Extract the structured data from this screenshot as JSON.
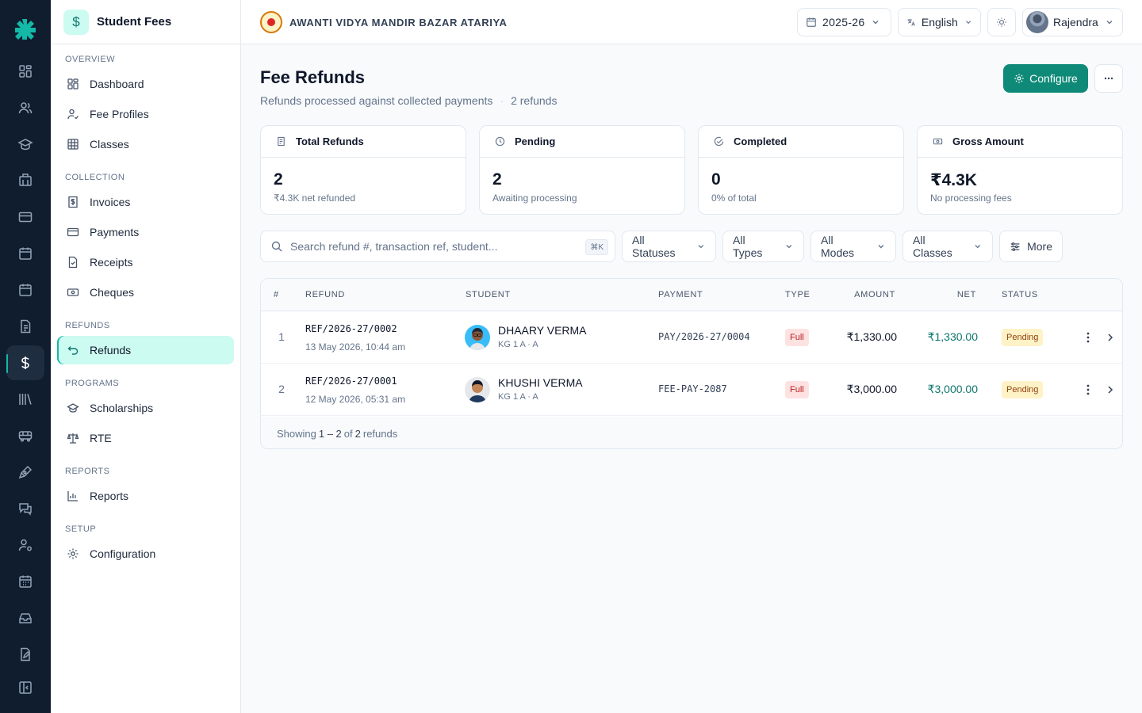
{
  "app": {
    "title": "Student Fees",
    "app_icon": "dollar-icon"
  },
  "rail": {
    "icons": [
      "dashboard-icon",
      "users-icon",
      "graduation-cap-icon",
      "building-icon",
      "credit-card-icon",
      "calendar-icon",
      "calendar-icon",
      "document-icon",
      "dollar-icon",
      "library-icon",
      "bus-icon",
      "pen-icon",
      "chat-icon",
      "user-gear-icon",
      "calendar-grid-icon",
      "inbox-icon",
      "file-edit-icon",
      "collapse-sidebar-icon"
    ],
    "active": "dollar-icon"
  },
  "sidebar": {
    "overview_label": "OVERVIEW",
    "collection_label": "COLLECTION",
    "refunds_label": "REFUNDS",
    "programs_label": "PROGRAMS",
    "reports_label": "REPORTS",
    "setup_label": "SETUP",
    "items": {
      "dashboard": "Dashboard",
      "fee_profiles": "Fee Profiles",
      "classes": "Classes",
      "invoices": "Invoices",
      "payments": "Payments",
      "receipts": "Receipts",
      "cheques": "Cheques",
      "refunds": "Refunds",
      "scholarships": "Scholarships",
      "rte": "RTE",
      "reports": "Reports",
      "configuration": "Configuration"
    },
    "active_item": "Refunds"
  },
  "topbar": {
    "school_name": "AWANTI VIDYA MANDIR BAZAR ATARIYA",
    "academic_year": "2025-26",
    "language": "English",
    "user_name": "Rajendra"
  },
  "page": {
    "title": "Fee Refunds",
    "subtitle": "Refunds processed against collected payments",
    "count_text": "2 refunds",
    "configure_label": "Configure"
  },
  "stats": {
    "total": {
      "label": "Total Refunds",
      "value": "2",
      "sub": "₹4.3K net refunded"
    },
    "pending": {
      "label": "Pending",
      "value": "2",
      "sub": "Awaiting processing"
    },
    "completed": {
      "label": "Completed",
      "value": "0",
      "sub": "0% of total"
    },
    "gross": {
      "label": "Gross Amount",
      "value": "₹4.3K",
      "sub": "No processing fees"
    }
  },
  "filters": {
    "search_placeholder": "Search refund #, transaction ref, student...",
    "search_shortcut": "⌘K",
    "status": "All Statuses",
    "type": "All Types",
    "mode": "All Modes",
    "classes": "All Classes",
    "more": "More"
  },
  "table": {
    "headers": {
      "idx": "#",
      "refund": "REFUND",
      "student": "STUDENT",
      "payment": "PAYMENT",
      "type": "TYPE",
      "amount": "AMOUNT",
      "net": "NET",
      "status": "STATUS"
    },
    "rows": [
      {
        "idx": "1",
        "ref": "REF/2026-27/0002",
        "date": "13 May 2026, 10:44 am",
        "student": "DHAARY VERMA",
        "class": "KG 1 A · A",
        "payment": "PAY/2026-27/0004",
        "type": "Full",
        "amount": "₹1,330.00",
        "net": "₹1,330.00",
        "status": "Pending"
      },
      {
        "idx": "2",
        "ref": "REF/2026-27/0001",
        "date": "12 May 2026, 05:31 am",
        "student": "KHUSHI VERMA",
        "class": "KG 1 A · A",
        "payment": "FEE-PAY-2087",
        "type": "Full",
        "amount": "₹3,000.00",
        "net": "₹3,000.00",
        "status": "Pending"
      }
    ],
    "footer": {
      "prefix": "Showing",
      "range": "1 – 2",
      "of": "of",
      "total": "2",
      "suffix": "refunds"
    }
  },
  "colors": {
    "accent": "#0f8a78",
    "rail_bg": "#0f1d2e",
    "active_bg": "#ccfbf1",
    "pending_bg": "#fef3c7",
    "full_bg": "#fee2e2"
  }
}
